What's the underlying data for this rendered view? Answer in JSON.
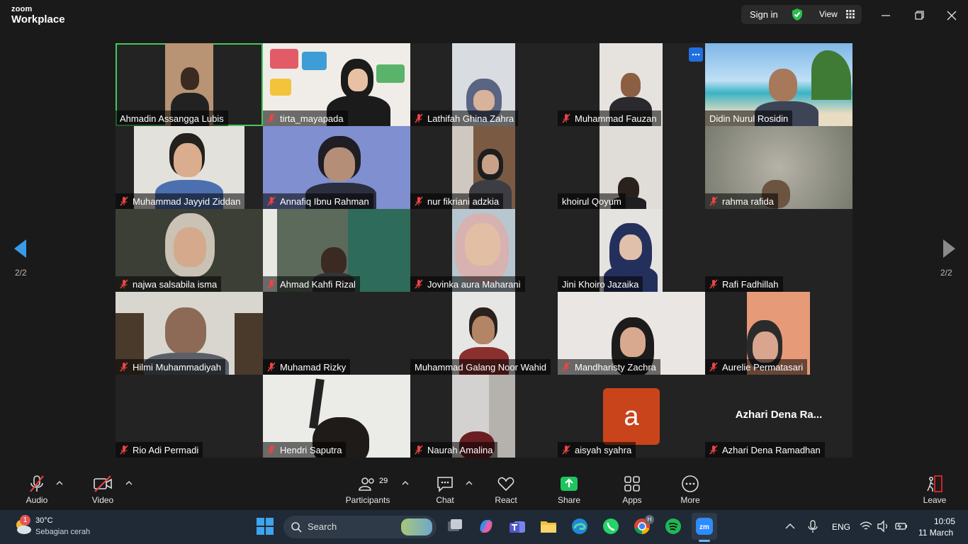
{
  "app": {
    "brand_top": "zoom",
    "brand_bottom": "Workplace"
  },
  "topbar": {
    "sign_in": "Sign in",
    "view": "View"
  },
  "pager": {
    "left": "2/2",
    "right": "2/2"
  },
  "participants": [
    {
      "name": "Ahmadin Assangga Lubis",
      "muted": false,
      "active": true
    },
    {
      "name": "tirta_mayapada",
      "muted": true
    },
    {
      "name": "Lathifah Ghina Zahra",
      "muted": true
    },
    {
      "name": "Muhammad Fauzan",
      "muted": true
    },
    {
      "name": "Didin Nurul Rosidin",
      "muted": false
    },
    {
      "name": "Muhammad Jayyid Ziddan",
      "muted": true
    },
    {
      "name": "Annafiq Ibnu Rahman",
      "muted": true
    },
    {
      "name": "nur fikriani adzkia",
      "muted": true
    },
    {
      "name": "khoirul Qoyum",
      "muted": false
    },
    {
      "name": "rahma rafida",
      "muted": true
    },
    {
      "name": "najwa salsabila isma",
      "muted": true
    },
    {
      "name": "Ahmad Kahfi Rizal",
      "muted": true
    },
    {
      "name": "Jovinka aura Maharani",
      "muted": true
    },
    {
      "name": "Jini Khoiro Jazaika",
      "muted": false
    },
    {
      "name": "Rafi Fadhillah",
      "muted": true
    },
    {
      "name": "Hilmi Muhammadiyah",
      "muted": true
    },
    {
      "name": "Muhamad Rizky",
      "muted": true
    },
    {
      "name": "Muhammad Galang Noor Wahid",
      "muted": false
    },
    {
      "name": "Mandharisty Zachra",
      "muted": true
    },
    {
      "name": "Aurelie Permatasari",
      "muted": true
    },
    {
      "name": "Rio Adi Permadi",
      "muted": true
    },
    {
      "name": "Hendri Saputra",
      "muted": true
    },
    {
      "name": "Naurah Amalina",
      "muted": true
    },
    {
      "name": "aisyah syahra",
      "muted": true,
      "avatar_letter": "a"
    },
    {
      "name": "Azhari Dena Ramadhan",
      "muted": true,
      "center_label": "Azhari Dena Ra..."
    }
  ],
  "toolbar": {
    "audio": "Audio",
    "video": "Video",
    "participants": "Participants",
    "participants_count": "29",
    "chat": "Chat",
    "react": "React",
    "share": "Share",
    "apps": "Apps",
    "more": "More",
    "leave": "Leave"
  },
  "taskbar": {
    "weather_temp": "30°C",
    "weather_desc": "Sebagian cerah",
    "weather_badge": "1",
    "search": "Search",
    "lang": "ENG",
    "time": "10:05",
    "date": "11 March",
    "chrome_badge": "H"
  },
  "colors": {
    "active_border": "#45c95a",
    "share_green": "#1fc45e",
    "leave_red": "#e0262d",
    "avatar_orange": "#c9431b"
  }
}
